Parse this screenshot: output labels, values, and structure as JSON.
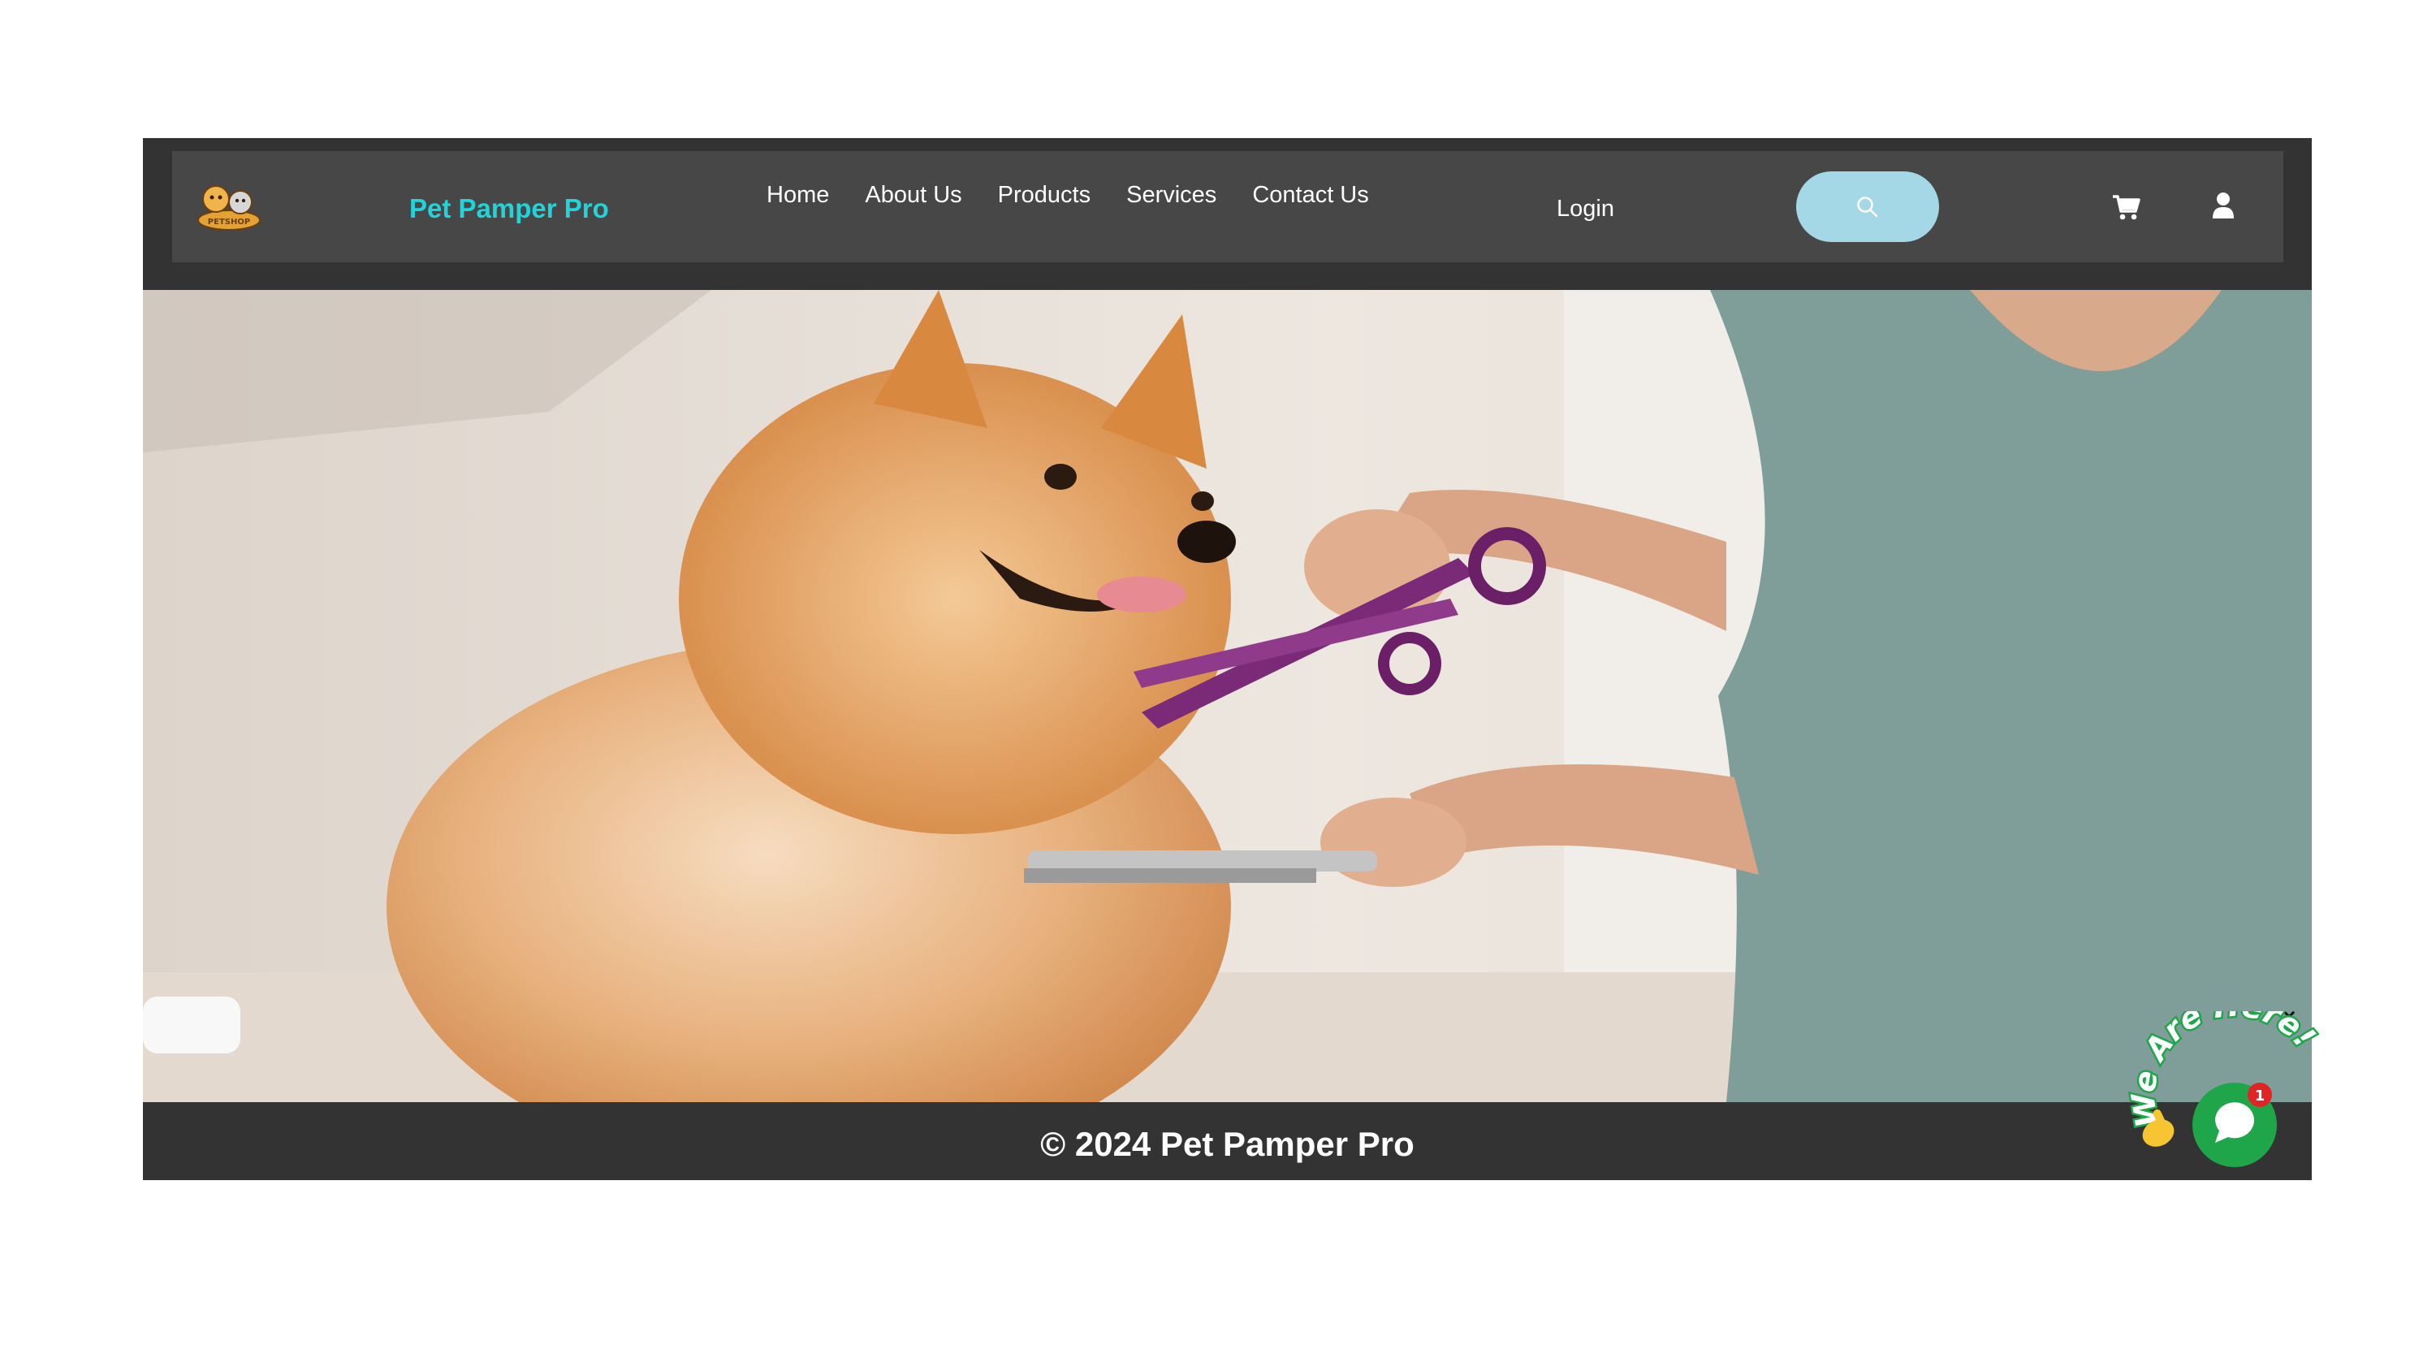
{
  "header": {
    "brand": "Pet Pamper Pro",
    "logo_text": "PETSHOP",
    "nav": [
      "Home",
      "About Us",
      "Products",
      "Services",
      "Contact Us"
    ],
    "login": "Login",
    "search_icon": "search-icon",
    "cart_icon": "cart-icon",
    "user_icon": "user-icon"
  },
  "hero": {
    "image": "pomeranian-grooming-photo"
  },
  "footer": {
    "copyright": "© 2024 Pet Pamper Pro"
  },
  "chat": {
    "banner": "We Are Here!",
    "badge": "1",
    "close": "×"
  },
  "colors": {
    "brand": "#22d3d8",
    "navbar": "#474747",
    "page_dark": "#333333",
    "search_button": "#a5d8e6",
    "chat_green": "#1fa64a",
    "badge_red": "#e02424"
  }
}
